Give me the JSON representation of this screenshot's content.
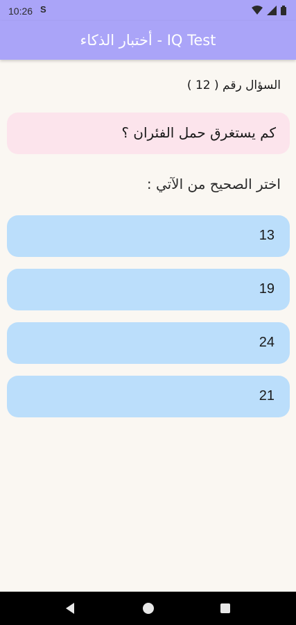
{
  "status_bar": {
    "time": "10:26",
    "sim_icon": "S"
  },
  "app_bar": {
    "title": "أختبار الذكاء - IQ Test"
  },
  "question": {
    "number_label": "السؤال رقم ( 12 )",
    "text": "كم يستغرق حمل الفئران ؟",
    "instruction": "اختر الصحيح من الآتي :"
  },
  "options": [
    "13",
    "19",
    "24",
    "21"
  ],
  "colors": {
    "app_bar": "#aaa4f8",
    "question_card": "#fce4ec",
    "option_card": "#bbdefb",
    "background": "#faf7f2"
  },
  "icons": [
    "sim-icon",
    "wifi-icon",
    "signal-icon",
    "battery-icon",
    "back-icon",
    "home-icon",
    "recent-apps-icon"
  ]
}
